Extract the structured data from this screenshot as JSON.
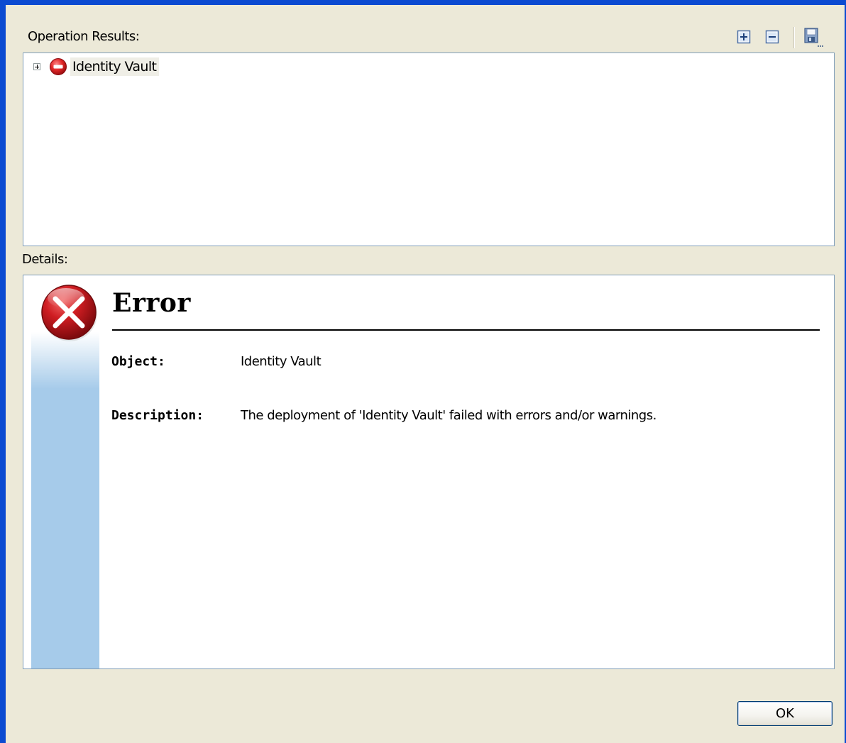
{
  "operation_results": {
    "label": "Operation Results:",
    "toolbar": {
      "expand_all_icon": "expand-all-icon",
      "collapse_all_icon": "collapse-all-icon",
      "save_icon": "save-icon"
    },
    "tree": [
      {
        "label": "Identity Vault",
        "status": "error",
        "icon": "error-status-icon"
      }
    ]
  },
  "details": {
    "label": "Details:",
    "title": "Error",
    "icon": "error-x-icon",
    "object_label": "Object:",
    "object_value": "Identity Vault",
    "description_label": "Description:",
    "description_value": "The deployment of 'Identity Vault' failed with errors and/or warnings."
  },
  "buttons": {
    "ok": "OK"
  },
  "colors": {
    "window_frame": "#0b4ad1",
    "dialog_background": "#ece9d8",
    "error_red": "#c8151b",
    "details_strip_blue": "#a6cbea"
  }
}
